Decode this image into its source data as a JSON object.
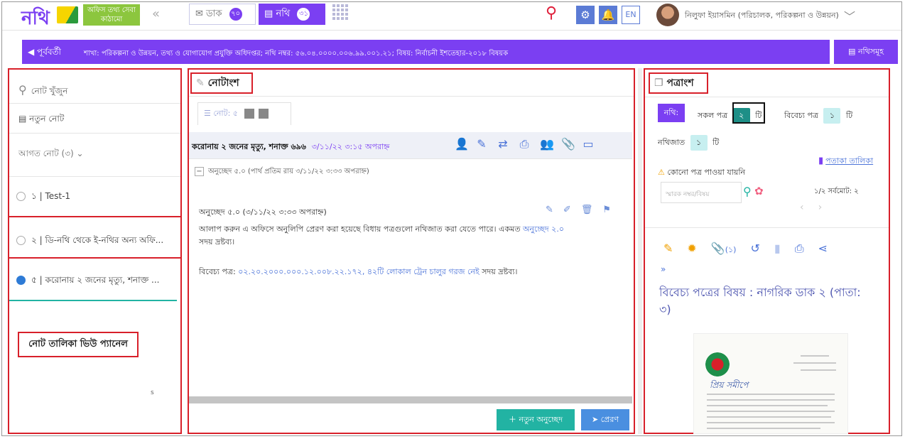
{
  "header": {
    "logo_text": "নথি",
    "logo_tagline": "অফিস তথ্য সেবা কাঠামো",
    "collapse_icon": "«",
    "tabs": [
      {
        "label": "ডাক",
        "badge": "৭০",
        "icon": "mail-icon"
      },
      {
        "label": "নথি",
        "badge": "৩১",
        "icon": "folder-icon"
      }
    ],
    "lang_label": "EN",
    "user_name": "নিলুফা ইয়াসমিন (পরিচালক, পরিকল্পনা ও উন্নয়ন)"
  },
  "subbar": {
    "back_label": "পূর্ববর্তী",
    "breadcrumb": "শাখা: পরিকল্পনা ও উন্নয়ন, তথ্য ও যোগাযোগ প্রযুক্তি অধিদপ্তর; নথি নম্বর: ৫৬.০৪.০০০০.০০৬.৯৯.০০১.২১; বিষয়: নির্বাচনী ইশতেহার-২০১৮ বিষয়ক",
    "nothi_list_label": "নথিসমূহ"
  },
  "left_panel": {
    "search_placeholder": "নোট খুঁজুন",
    "new_note_label": "নতুন নোট",
    "incoming_label": "আগত নোট (৩)",
    "notes": [
      {
        "num": "১",
        "title": "Test-1",
        "checked": false
      },
      {
        "num": "২",
        "title": "ডি-নথি থেকে ই-নথির অন্য অফি...",
        "checked": false
      },
      {
        "num": "৫",
        "title": "করোনায় ২ জনের মৃত্যু, শনাক্ত ...",
        "checked": true
      }
    ],
    "panel_label": "নোট তালিকা ভিউ প্যানেল",
    "stray_letter": "s"
  },
  "middle_panel": {
    "heading": "নোটাংশ",
    "tab_label": "নোট: ৫",
    "note_title": "করোনায় ২ জনের মৃত্যু, শনাক্ত ৬৯৬",
    "note_datetime": "৩/১১/২২ ৩:১৫ অপরাহ্ন",
    "para_summary": "অনুচ্ছেদ ৫.০ (পার্থ প্রতিম রায় ৩/১১/২২ ৩:৩৩ অপরাহ্ন)",
    "para_head": "অনুচ্ছেদ ৫.০ (৩/১১/২২ ৩:৩৩ অপরাহ্ন)",
    "para_body": "আলাপ করুন এ অফিসে অনুলিপি প্রেরণ করা হয়েছে বিধায় পত্রগুলো নথিজাত করা যেতে পারে। একমত",
    "para_link": "অনুচ্ছেদ ২.০",
    "para_tail": "সদয় দ্রষ্টব্য।",
    "bibechyo_label": "বিবেচ্য পত্র:",
    "bibechyo_ref": "০২.২০.২০০০.০০০.১২.০০৮.২২.১৭২, ৪২টি লোকাল ট্রেন চালুর গরজ নেই",
    "bibechyo_tail": "সদয় দ্রষ্টব্য।",
    "new_para_button": "নতুন অনুচ্ছেদ",
    "send_button": "প্রেরণ"
  },
  "right_panel": {
    "heading": "পত্রাংশ",
    "nothi_label": "নথি:",
    "all_papers_label": "সকল পত্র",
    "all_papers_count": "২",
    "unit_label": "টি",
    "bibechyo_label": "বিবেচ্য পত্র",
    "bibechyo_count": "১",
    "nothijat_label": "নথিজাত",
    "nothijat_count": "১",
    "flag_list_label": "পতাকা তালিকা",
    "no_paper_label": "কোনো পত্র পাওয়া যায়নি",
    "search_placeholder": "স্মারক নম্বর/বিষয়",
    "page_info": "১/২ সর্বমোট: ২",
    "attachment_count": "(১)",
    "subject": "বিবেচ্য পত্রের বিষয় : নাগরিক ডাক ২ (পাতা: ৩)",
    "doc_salutation": "প্রিয় সমীপে"
  },
  "colors": {
    "primary_purple": "#7b3ff2",
    "teal": "#22b3a3",
    "annotation_red": "#d8202a",
    "link_blue": "#4a72d8"
  }
}
